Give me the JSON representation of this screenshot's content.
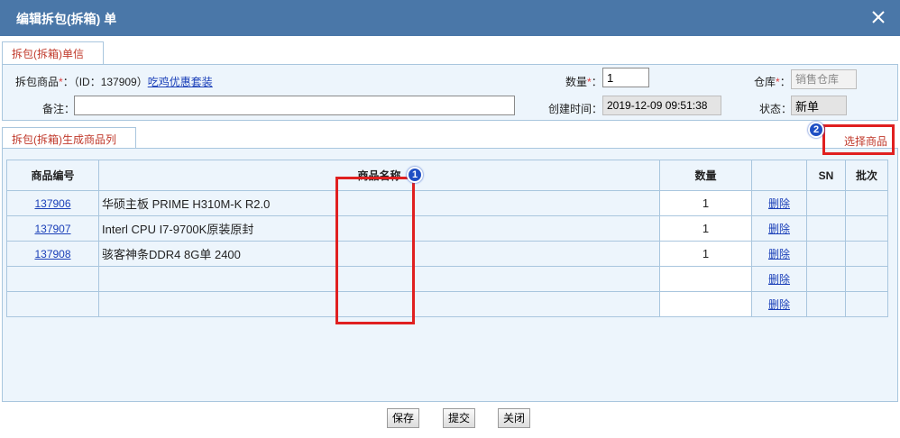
{
  "window": {
    "title": "编辑拆包(拆箱) 单",
    "close_icon": "close-icon"
  },
  "tabs": {
    "info_tab": "拆包(拆箱)单信息",
    "list_tab": "拆包(拆箱)生成商品列表"
  },
  "form": {
    "product_label": "拆包商品",
    "required_mark": "*",
    "product_id_text": "：（ID：137909）",
    "product_link": "吃鸡优惠套装",
    "quantity_label": "数量",
    "quantity_value": "1",
    "warehouse_label": "仓库",
    "warehouse_value": "销售仓库",
    "remark_label": "备注：",
    "remark_value": "",
    "created_label": "创建时间：",
    "created_value": "2019-12-09 09:51:38",
    "status_label": "状态：",
    "status_value": "新单",
    "colon": "："
  },
  "actions": {
    "select_products": "选择商品"
  },
  "annotations": {
    "badge1": "1",
    "badge2": "2",
    "color": "#e02020"
  },
  "table": {
    "headers": [
      "商品编号",
      "商品名称",
      "数量",
      "",
      "SN",
      "批次"
    ],
    "delete_label": "删除",
    "rows": [
      {
        "code": "137906",
        "name": "华硕主板 PRIME H310M-K R2.0",
        "qty": "1"
      },
      {
        "code": "137907",
        "name": "Interl CPU I7-9700K原装原封",
        "qty": "1"
      },
      {
        "code": "137908",
        "name": "骇客神条DDR4 8G单 2400",
        "qty": "1"
      },
      {
        "code": "",
        "name": "",
        "qty": ""
      },
      {
        "code": "",
        "name": "",
        "qty": ""
      }
    ]
  },
  "footer": {
    "save": "保存",
    "submit": "提交",
    "close": "关闭"
  },
  "colors": {
    "titlebar": "#4a77a8",
    "panel_bg": "#edf5fc",
    "border": "#a9c6de",
    "tab_text": "#c0392b",
    "link": "#1a3fb8"
  }
}
